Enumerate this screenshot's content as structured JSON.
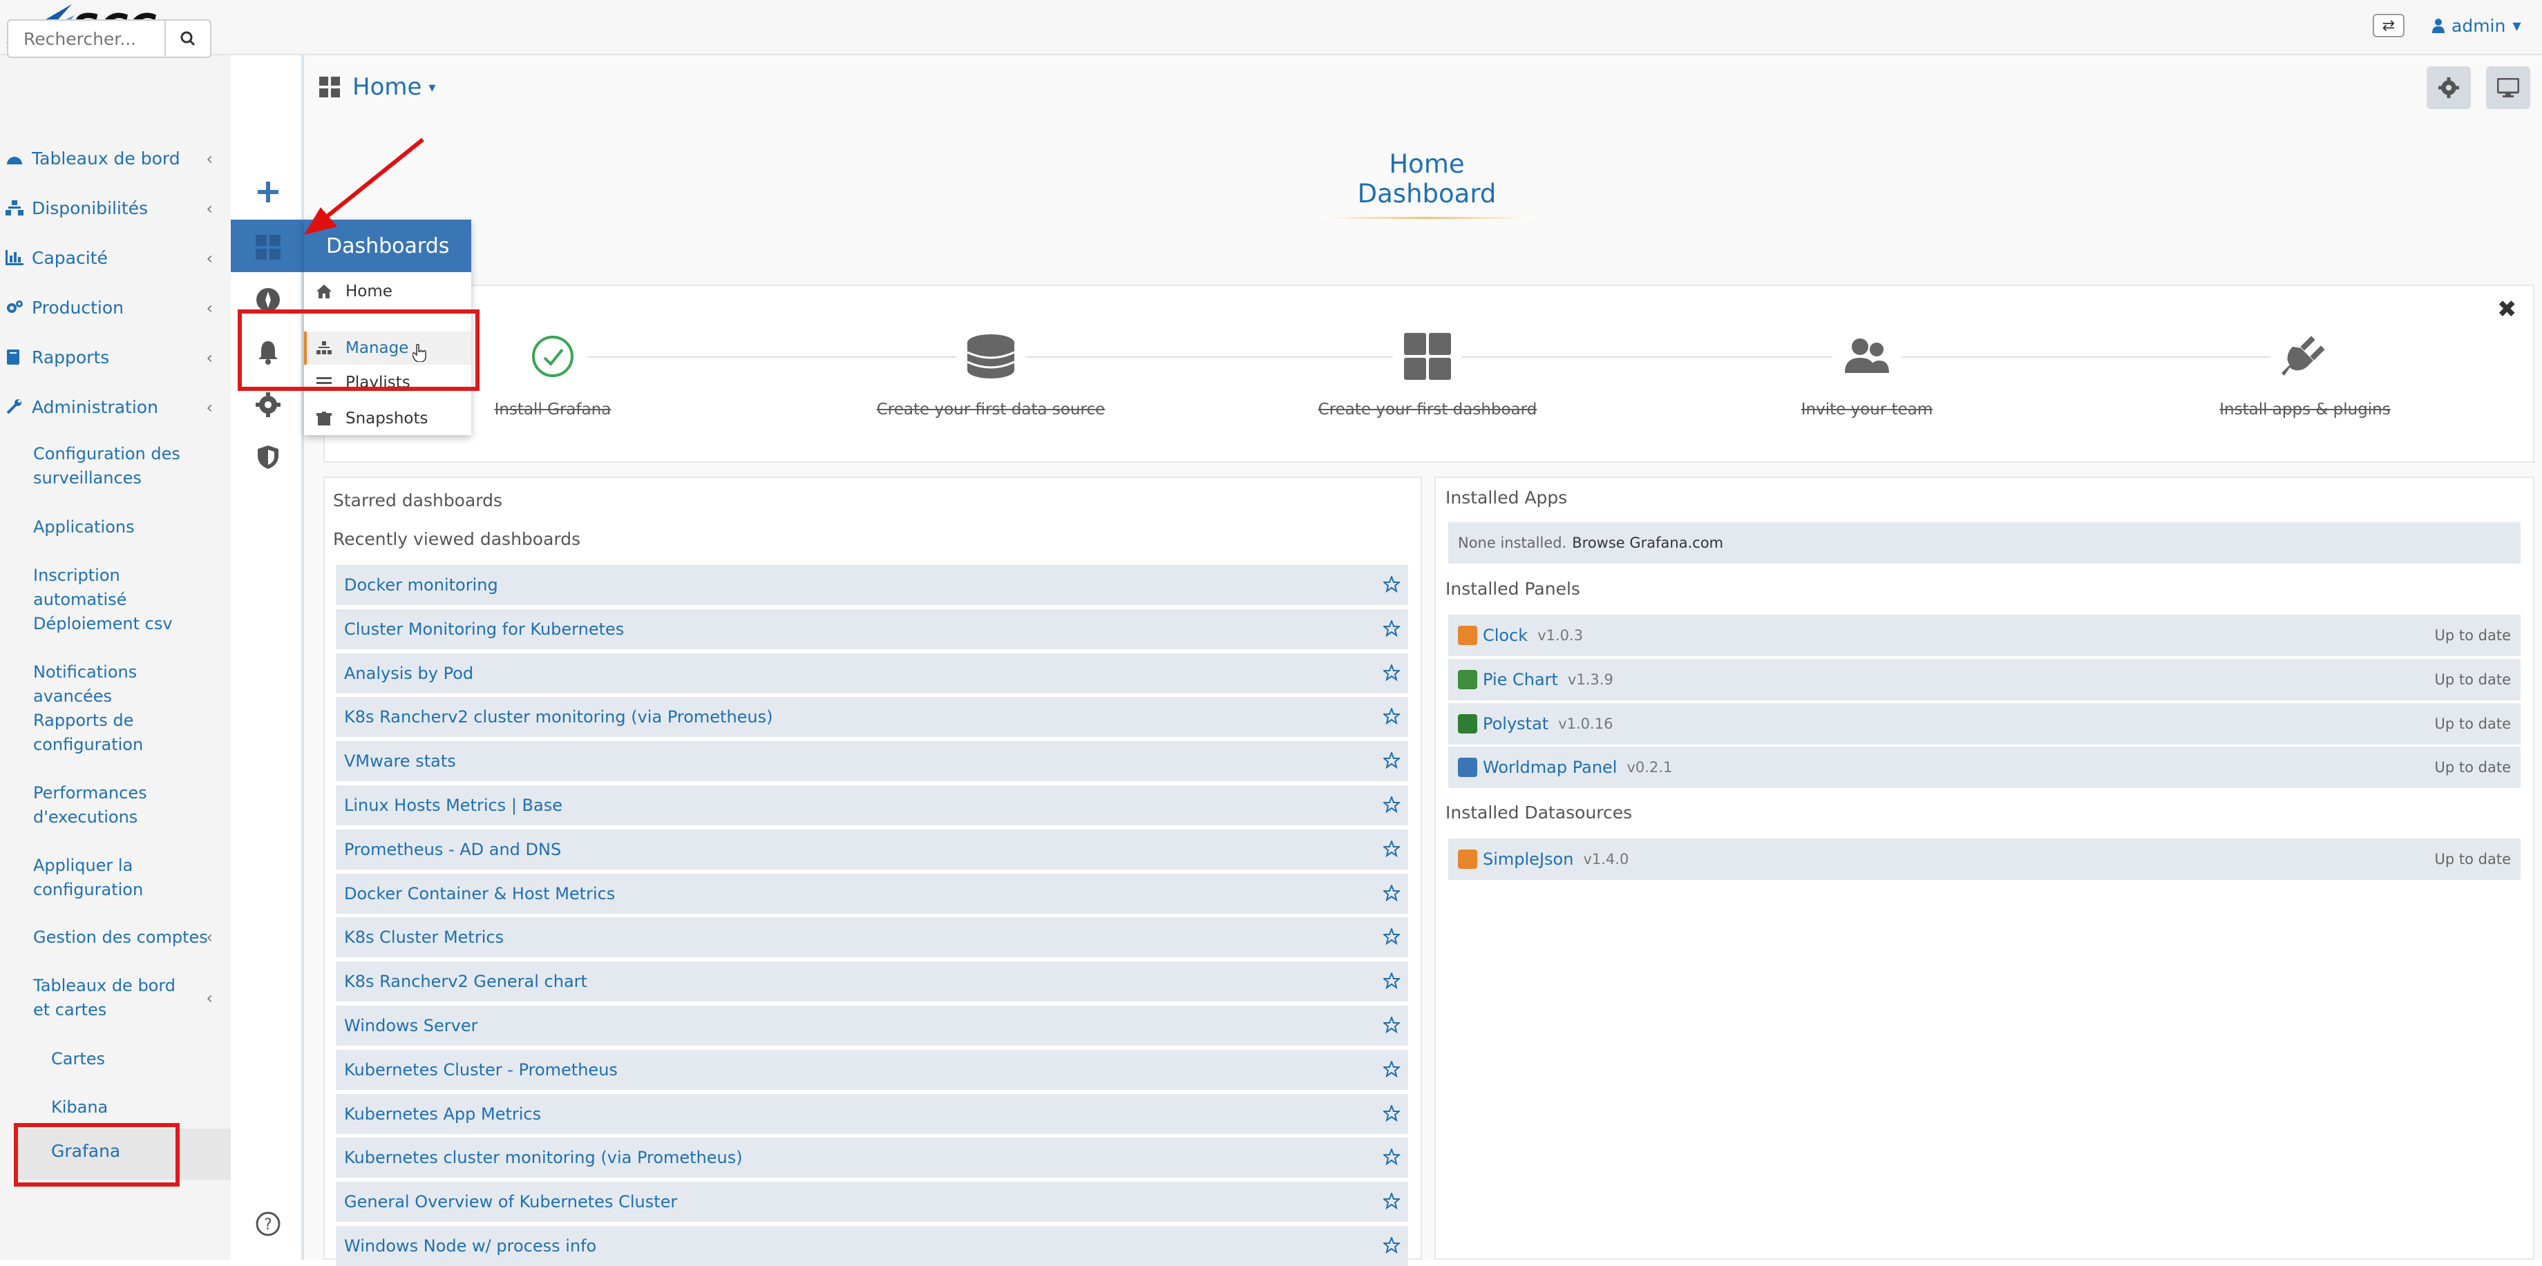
{
  "header": {
    "logo_text": "SCC",
    "swap_icon": "exchange-icon",
    "user": "admin"
  },
  "sidebar": {
    "search_placeholder": "Rechercher...",
    "nav": [
      {
        "label": "Tableaux de bord",
        "icon": "dashboard-icon"
      },
      {
        "label": "Disponibilités",
        "icon": "sitemap-icon"
      },
      {
        "label": "Capacité",
        "icon": "bar-chart-icon"
      },
      {
        "label": "Production",
        "icon": "cogs-icon"
      },
      {
        "label": "Rapports",
        "icon": "book-icon"
      },
      {
        "label": "Administration",
        "icon": "wrench-icon"
      }
    ],
    "admin_items": [
      "Configuration des surveillances",
      "Applications",
      "Inscription automatisé",
      "Déploiement csv",
      "Notifications avancées",
      "Rapports de configuration",
      "Performances d'executions",
      "Appliquer la configuration",
      "Gestion des comptes",
      "Tableaux de bord et cartes"
    ],
    "boards_items": [
      "Cartes",
      "Kibana",
      "Grafana"
    ],
    "help_icon": "help-icon"
  },
  "grafana_menu": {
    "title": "Dashboards",
    "items": [
      {
        "label": "Home",
        "icon": "home-icon"
      },
      {
        "label": "Manage",
        "icon": "sitemap-icon"
      },
      {
        "label": "Playlists",
        "icon": "playlist-icon"
      },
      {
        "label": "Snapshots",
        "icon": "snapshot-icon"
      }
    ]
  },
  "main": {
    "breadcrumb": "Home",
    "page_title": "Home Dashboard",
    "getting_started": [
      "Install Grafana",
      "Create your first data source",
      "Create your first dashboard",
      "Invite your team",
      "Install apps & plugins"
    ],
    "starred_heading": "Starred dashboards",
    "recent_heading": "Recently viewed dashboards",
    "recent": [
      "Docker monitoring",
      "Cluster Monitoring for Kubernetes",
      "Analysis by Pod",
      "K8s Rancherv2 cluster monitoring (via Prometheus)",
      "VMware stats",
      "Linux Hosts Metrics | Base",
      "Prometheus - AD and DNS",
      "Docker Container & Host Metrics",
      "K8s Cluster Metrics",
      "K8s Rancherv2 General chart",
      "Windows Server",
      "Kubernetes Cluster - Prometheus",
      "Kubernetes App Metrics",
      "Kubernetes cluster monitoring (via Prometheus)",
      "General Overview of Kubernetes Cluster",
      "Windows Node w/ process info"
    ],
    "installed_apps_heading": "Installed Apps",
    "none_installed": "None installed.",
    "browse_link": "Browse Grafana.com",
    "installed_panels_heading": "Installed Panels",
    "panels": [
      {
        "name": "Clock",
        "version": "v1.0.3",
        "status": "Up to date",
        "color": "#e8852a"
      },
      {
        "name": "Pie Chart",
        "version": "v1.3.9",
        "status": "Up to date",
        "color": "#3c8d3c"
      },
      {
        "name": "Polystat",
        "version": "v1.0.16",
        "status": "Up to date",
        "color": "#2e7d32"
      },
      {
        "name": "Worldmap Panel",
        "version": "v0.2.1",
        "status": "Up to date",
        "color": "#3a76b5"
      }
    ],
    "installed_ds_heading": "Installed Datasources",
    "datasources": [
      {
        "name": "SimpleJson",
        "version": "v1.4.0",
        "status": "Up to date",
        "color": "#e8852a"
      }
    ]
  },
  "colors": {
    "accent": "#1f6fb5",
    "menu_header": "#3a76b5",
    "highlight": "#dd1a1a"
  }
}
